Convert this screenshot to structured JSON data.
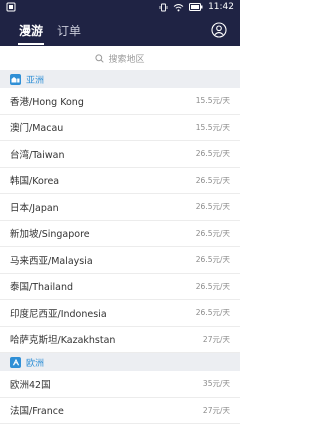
{
  "status_bar": {
    "time": "11:42",
    "icons": [
      "app-notification-icon",
      "vibrate-icon",
      "wifi-icon",
      "battery-icon"
    ]
  },
  "header": {
    "tabs": [
      {
        "label": "漫游",
        "active": true
      },
      {
        "label": "订单",
        "active": false
      }
    ],
    "account_icon": "account-icon"
  },
  "search": {
    "placeholder": "搜索地区",
    "icon": "search-icon"
  },
  "sections": [
    {
      "title": "亚洲",
      "items": [
        {
          "name": "香港/Hong Kong",
          "price": "15.5元/天"
        },
        {
          "name": "澳门/Macau",
          "price": "15.5元/天"
        },
        {
          "name": "台湾/Taiwan",
          "price": "26.5元/天"
        },
        {
          "name": "韩国/Korea",
          "price": "26.5元/天"
        },
        {
          "name": "日本/Japan",
          "price": "26.5元/天"
        },
        {
          "name": "新加坡/Singapore",
          "price": "26.5元/天"
        },
        {
          "name": "马来西亚/Malaysia",
          "price": "26.5元/天"
        },
        {
          "name": "泰国/Thailand",
          "price": "26.5元/天"
        },
        {
          "name": "印度尼西亚/Indonesia",
          "price": "26.5元/天"
        },
        {
          "name": "哈萨克斯坦/Kazakhstan",
          "price": "27元/天"
        }
      ]
    },
    {
      "title": "欧洲",
      "items": [
        {
          "name": "欧洲42国",
          "price": "35元/天"
        },
        {
          "name": "法国/France",
          "price": "27元/天"
        }
      ]
    }
  ],
  "colors": {
    "header_bg": "#1f2344",
    "accent": "#2f8fd6",
    "section_bg": "#eceef2"
  }
}
